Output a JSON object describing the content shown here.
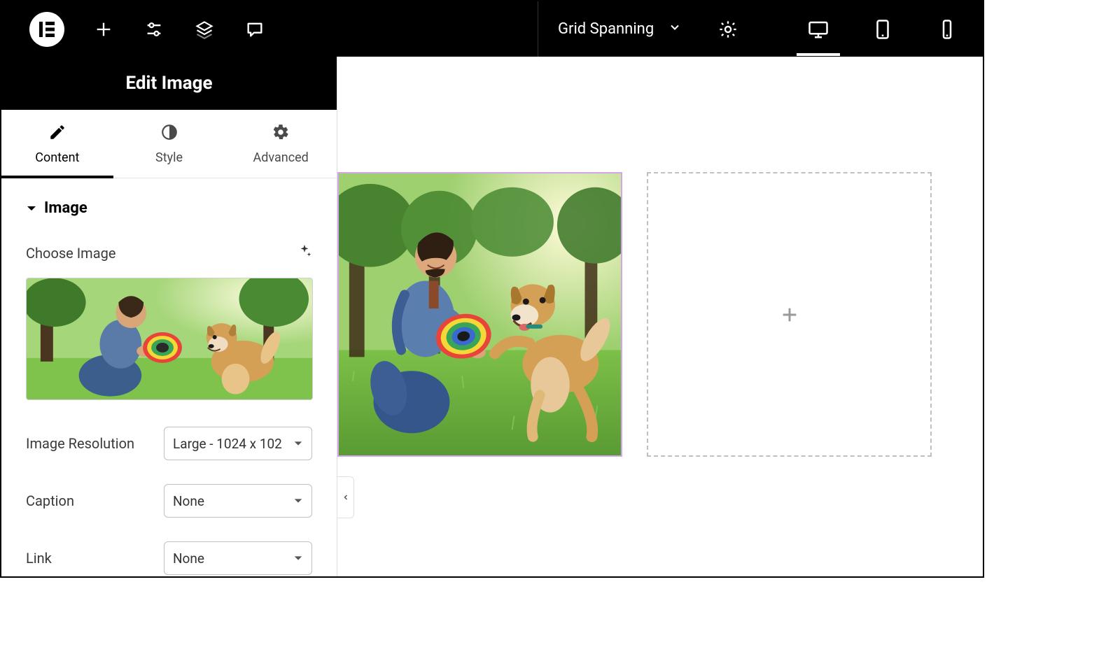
{
  "header": {
    "breadcrumb": "Grid Spanning"
  },
  "sidebar": {
    "title": "Edit Image",
    "tabs": [
      {
        "label": "Content",
        "icon": "pencil",
        "active": true
      },
      {
        "label": "Style",
        "icon": "contrast",
        "active": false
      },
      {
        "label": "Advanced",
        "icon": "gear",
        "active": false
      }
    ]
  },
  "section": {
    "title": "Image",
    "choose_label": "Choose Image",
    "fields": [
      {
        "label": "Image Resolution",
        "value": "Large - 1024 x 102"
      },
      {
        "label": "Caption",
        "value": "None"
      },
      {
        "label": "Link",
        "value": "None"
      }
    ]
  },
  "devices": {
    "active": "desktop"
  }
}
